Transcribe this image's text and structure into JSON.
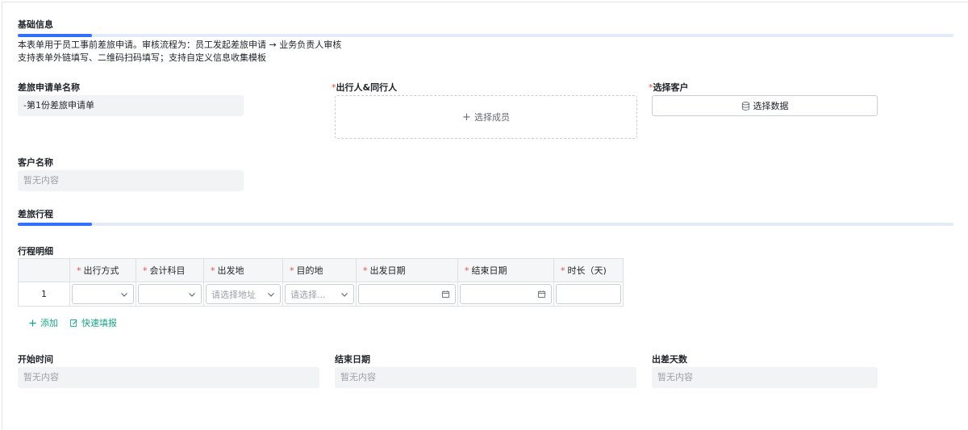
{
  "basic": {
    "title": "基础信息",
    "desc_line1": "本表单用于员工事前差旅申请。审核流程为：员工发起差旅申请 → 业务负责人审核",
    "desc_line2": "支持表单外链填写、二维码扫码填写；支持自定义信息收集模板",
    "form_name": {
      "label": "差旅申请单名称",
      "value": "-第1份差旅申请单"
    },
    "travelers": {
      "label": "出行人&同行人",
      "required_mark": "*",
      "button": "选择成员"
    },
    "customer_select": {
      "label": "选择客户",
      "required_mark": "*",
      "button": "选择数据"
    },
    "customer_name": {
      "label": "客户名称",
      "value": "暂无内容"
    }
  },
  "itinerary": {
    "title": "差旅行程",
    "detail_label": "行程明细",
    "required_mark": "*",
    "columns": [
      "出行方式",
      "会计科目",
      "出发地",
      "目的地",
      "出发日期",
      "结束日期",
      "时长（天)"
    ],
    "rows": [
      {
        "index": "1",
        "departure_placeholder": "请选择地址",
        "destination_placeholder": "请选择..."
      }
    ],
    "add_label": "添加",
    "quick_fill_label": "快速填报"
  },
  "summary": {
    "start": {
      "label": "开始时间",
      "value": "暂无内容"
    },
    "end": {
      "label": "结束日期",
      "value": "暂无内容"
    },
    "days": {
      "label": "出差天数",
      "value": "暂无内容"
    }
  },
  "colors": {
    "accent": "#3370ff",
    "required": "#f54a45",
    "action": "#14a785",
    "readonly_bg": "#f2f3f5"
  },
  "icons": {
    "member_add": "plus-icon",
    "select_data": "database-icon",
    "dropdown": "chevron-down-icon",
    "date": "calendar-icon",
    "add_row": "plus-icon",
    "quick_fill": "edit-icon"
  }
}
